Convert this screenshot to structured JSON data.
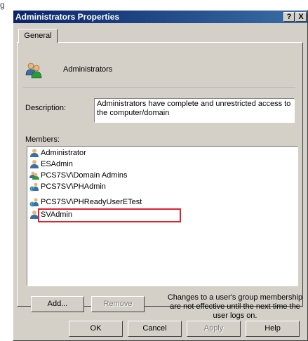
{
  "caption": "g",
  "window": {
    "title": "Administrators Properties",
    "help_button": "?",
    "close_button": "X"
  },
  "tabs": [
    {
      "label": "General"
    }
  ],
  "group": {
    "name": "Administrators",
    "icon": "group-icon"
  },
  "description": {
    "label": "Description:",
    "value": "Administrators have complete and unrestricted access to the computer/domain"
  },
  "members": {
    "label": "Members:",
    "items": [
      {
        "label": "Administrator",
        "icon": "user-icon"
      },
      {
        "label": "ESAdmin",
        "icon": "user-icon"
      },
      {
        "label": "PCS7SV\\Domain Admins",
        "icon": "domain-group-icon"
      },
      {
        "label": "PCS7SV\\PHAdmin",
        "icon": "domain-user-icon"
      },
      {
        "label": "PCS7SV\\PHReadyUserETest",
        "icon": "domain-user-icon"
      },
      {
        "label": "SVAdmin",
        "icon": "user-icon"
      }
    ],
    "highlighted_item": "PCS7SV\\PHReadyUserETest",
    "highlight_color": "#e0202a"
  },
  "buttons": {
    "add": "Add...",
    "remove": "Remove",
    "ok": "OK",
    "cancel": "Cancel",
    "apply": "Apply",
    "help": "Help"
  },
  "note": "Changes to a user's group membership are not effective until the next time the user logs on.",
  "colors": {
    "titlebar_start": "#0a246a",
    "titlebar_end": "#3a6ea5",
    "face": "#d4d0c8"
  }
}
